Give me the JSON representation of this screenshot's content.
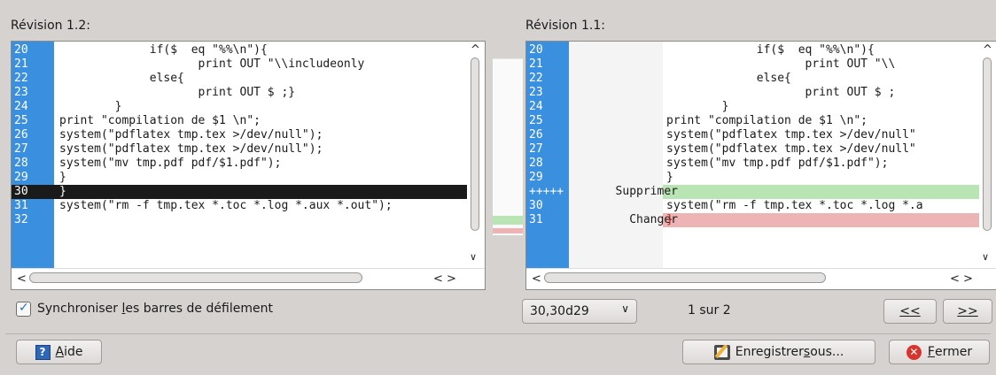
{
  "left_panel": {
    "title": "Révision 1.2:",
    "lines": [
      {
        "num": "20",
        "code": "             if($  eq \"%%\\n\"){"
      },
      {
        "num": "21",
        "code": "                    print OUT \"\\\\includeonly"
      },
      {
        "num": "22",
        "code": "             else{"
      },
      {
        "num": "23",
        "code": "                    print OUT $ ;}"
      },
      {
        "num": "24",
        "code": "        }"
      },
      {
        "num": "25",
        "code": "print \"compilation de $1 \\n\";"
      },
      {
        "num": "26",
        "code": "system(\"pdflatex tmp.tex >/dev/null\");"
      },
      {
        "num": "27",
        "code": "system(\"pdflatex tmp.tex >/dev/null\");"
      },
      {
        "num": "28",
        "code": "system(\"mv tmp.pdf pdf/$1.pdf\");"
      },
      {
        "num": "29",
        "code": "}"
      },
      {
        "num": "30",
        "code": "}"
      },
      {
        "num": "31",
        "code": "system(\"rm -f tmp.tex *.toc *.log *.aux *.out\");"
      },
      {
        "num": "32",
        "code": ""
      }
    ]
  },
  "right_panel": {
    "title": "Révision 1.1:",
    "lines": [
      {
        "num": "20",
        "tag": "",
        "code": "             if($  eq \"%%\\n\"){"
      },
      {
        "num": "21",
        "tag": "",
        "code": "                    print OUT \"\\\\"
      },
      {
        "num": "22",
        "tag": "",
        "code": "             else{"
      },
      {
        "num": "23",
        "tag": "",
        "code": "                    print OUT $ ;"
      },
      {
        "num": "24",
        "tag": "",
        "code": "        }"
      },
      {
        "num": "25",
        "tag": "",
        "code": "print \"compilation de $1 \\n\";"
      },
      {
        "num": "26",
        "tag": "",
        "code": "system(\"pdflatex tmp.tex >/dev/null\""
      },
      {
        "num": "27",
        "tag": "",
        "code": "system(\"pdflatex tmp.tex >/dev/null\""
      },
      {
        "num": "28",
        "tag": "",
        "code": "system(\"mv tmp.pdf pdf/$1.pdf\");"
      },
      {
        "num": "29",
        "tag": "",
        "code": "}"
      },
      {
        "num": "+++++",
        "tag": "Supprimer",
        "code": ""
      },
      {
        "num": "30",
        "tag": "",
        "code": "system(\"rm -f tmp.tex *.toc *.log *.a"
      },
      {
        "num": "31",
        "tag": "Changer",
        "code": "}"
      }
    ]
  },
  "sync_label_pre": "Synchroniser ",
  "sync_label_ul": "l",
  "sync_label_post": "es barres de défilement",
  "sync_checked": true,
  "diff_select": "30,30d29",
  "diff_counter": "1 sur 2",
  "prev_button": "<<",
  "next_button": ">>",
  "help_button": {
    "pre": "",
    "ul": "A",
    "post": "ide"
  },
  "save_button": {
    "pre": "Enregistrer ",
    "ul": "s",
    "post": "ous..."
  },
  "close_button": {
    "pre": "",
    "ul": "F",
    "post": "ermer"
  },
  "colors": {
    "gutter": "#3a8fdf",
    "deleted": "#b9e4b3",
    "changed": "#ecb4b4",
    "selected": "#1a1a1a"
  }
}
